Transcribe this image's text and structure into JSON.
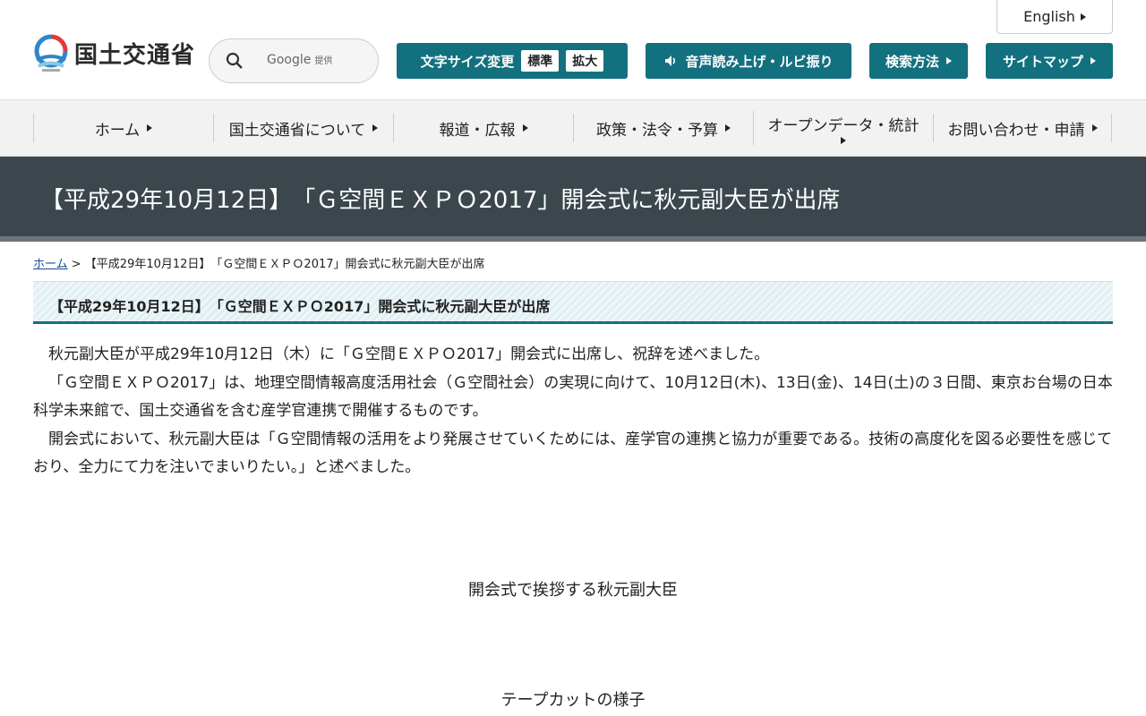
{
  "header": {
    "logo_text": "国土交通省",
    "lang_label": "English",
    "search": {
      "brand": "Google",
      "brand_sub": "提供",
      "placeholder": ""
    },
    "text_size": {
      "label": "文字サイズ変更",
      "normal": "標準",
      "large": "拡大"
    },
    "voice_label": "音声読み上げ・ルビ振り",
    "search_method_label": "検索方法",
    "sitemap_label": "サイトマップ"
  },
  "nav": {
    "items": [
      {
        "label": "ホーム"
      },
      {
        "label": "国土交通省について"
      },
      {
        "label": "報道・広報"
      },
      {
        "label": "政策・法令・予算"
      },
      {
        "label": "オープンデータ・統計"
      },
      {
        "label": "お問い合わせ・申請"
      }
    ]
  },
  "page": {
    "title": "【平成29年10月12日】　「Ｇ空間ＥＸＰＯ2017」開会式に秋元副大臣が出席",
    "breadcrumb_home": "ホーム",
    "breadcrumb_sep": " > ",
    "breadcrumb_current": "【平成29年10月12日】　「Ｇ空間ＥＸＰＯ2017」開会式に秋元副大臣が出席",
    "section_title": "【平成29年10月12日】　「Ｇ空間ＥＸＰＯ2017」開会式に秋元副大臣が出席",
    "paragraphs": [
      "秋元副大臣が平成29年10月12日（木）に「Ｇ空間ＥＸＰＯ2017」開会式に出席し、祝辞を述べました。",
      "「Ｇ空間ＥＸＰＯ2017」は、地理空間情報高度活用社会（Ｇ空間社会）の実現に向けて、10月12日(木)、13日(金)、14日(土)の３日間、東京お台場の日本科学未来館で、国土交通省を含む産学官連携で開催するものです。",
      "開会式において、秋元副大臣は「Ｇ空間情報の活用をより発展させていくためには、産学官の連携と協力が重要である。技術の高度化を図る必要性を感じており、全力にて力を注いでまいりたい。」と述べました。"
    ],
    "captions": [
      "開会式で挨拶する秋元副大臣",
      "テープカットの様子"
    ]
  },
  "colors": {
    "teal": "#13717f",
    "banner": "#3b474c",
    "nav_bg": "#f2f2f2"
  }
}
